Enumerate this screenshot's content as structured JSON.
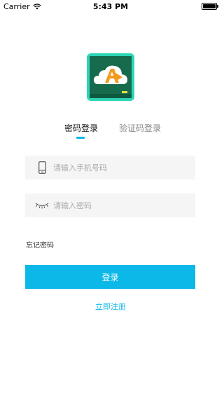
{
  "status_bar": {
    "carrier": "Carrier",
    "time": "5:43 PM",
    "icons": [
      "wifi-icon",
      "battery-icon"
    ]
  },
  "logo": {
    "icon": "app-logo-cloud-board",
    "colors": {
      "frame": "#2fd6b6",
      "board": "#176b4d",
      "cloud": "#ffffff",
      "letter": "#f39a1e"
    }
  },
  "tabs": [
    {
      "label": "密码登录",
      "active": true
    },
    {
      "label": "验证码登录",
      "active": false
    }
  ],
  "form": {
    "phone_placeholder": "请输入手机号码",
    "phone_value": "",
    "phone_icon": "phone-icon",
    "password_placeholder": "请输入密码",
    "password_value": "",
    "password_icon": "eye-closed-icon"
  },
  "forgot_password_label": "忘记密码",
  "login_button_label": "登录",
  "register_link_label": "立即注册",
  "colors": {
    "accent": "#0bb8e8",
    "input_bg": "#f5f5f5",
    "tab_inactive": "#888888"
  }
}
